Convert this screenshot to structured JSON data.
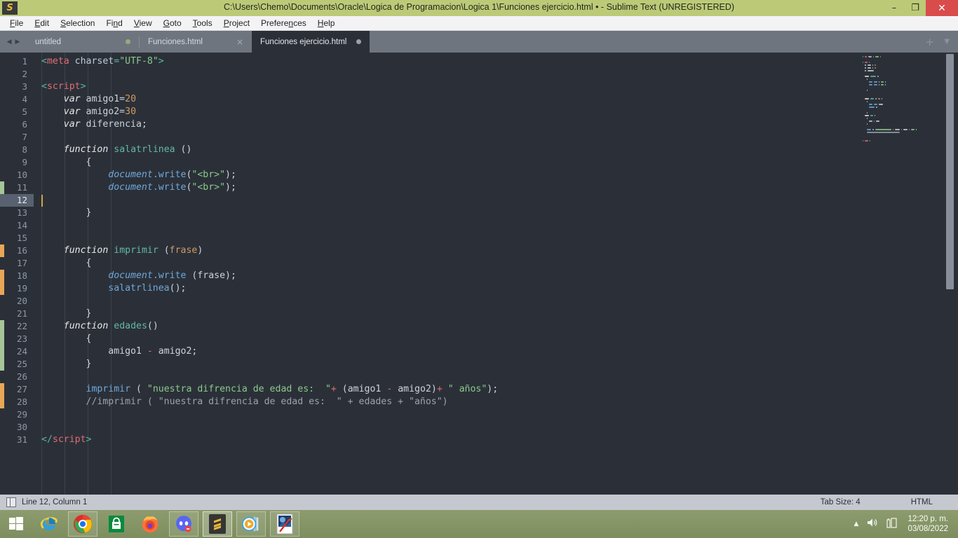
{
  "window": {
    "title": "C:\\Users\\Chemo\\Documents\\Oracle\\Logica de Programacion\\Logica 1\\Funciones ejercicio.html • - Sublime Text (UNREGISTERED)",
    "logo_glyph": "S",
    "minimize_glyph": "–",
    "maximize_glyph": "❐",
    "close_glyph": "✕"
  },
  "menubar": {
    "items": [
      {
        "pre": "",
        "accel": "F",
        "post": "ile"
      },
      {
        "pre": "",
        "accel": "E",
        "post": "dit"
      },
      {
        "pre": "",
        "accel": "S",
        "post": "election"
      },
      {
        "pre": "Fi",
        "accel": "n",
        "post": "d"
      },
      {
        "pre": "",
        "accel": "V",
        "post": "iew"
      },
      {
        "pre": "",
        "accel": "G",
        "post": "oto"
      },
      {
        "pre": "",
        "accel": "T",
        "post": "ools"
      },
      {
        "pre": "",
        "accel": "P",
        "post": "roject"
      },
      {
        "pre": "Prefere",
        "accel": "n",
        "post": "ces"
      },
      {
        "pre": "",
        "accel": "H",
        "post": "elp"
      }
    ]
  },
  "tabbar": {
    "prev_glyph": "◀",
    "next_glyph": "▶",
    "new_tab_glyph": "+",
    "menu_glyph": "▼",
    "close_glyph": "×",
    "tabs": [
      {
        "label": "untitled",
        "state": "dirty",
        "active": false
      },
      {
        "label": "Funciones.html",
        "state": "close",
        "active": false
      },
      {
        "label": "Funciones ejercicio.html",
        "state": "dirty-grey",
        "active": true
      }
    ]
  },
  "editor": {
    "cursor_line": 12,
    "first_line": 1,
    "gutter_markers": [
      {
        "line": 11,
        "type": "add"
      },
      {
        "line": 16,
        "type": "mod"
      },
      {
        "line": 18,
        "type": "mod"
      },
      {
        "line": 19,
        "type": "mod"
      },
      {
        "line": 22,
        "type": "add"
      },
      {
        "line": 23,
        "type": "add"
      },
      {
        "line": 24,
        "type": "add"
      },
      {
        "line": 25,
        "type": "add"
      },
      {
        "line": 27,
        "type": "mod"
      },
      {
        "line": 28,
        "type": "mod"
      }
    ],
    "lines": [
      {
        "n": 1,
        "tokens": [
          {
            "t": "<",
            "c": "t-punct"
          },
          {
            "t": "meta",
            "c": "t-tag"
          },
          {
            "t": " ",
            "c": "t-plain"
          },
          {
            "t": "charset",
            "c": "t-attrname"
          },
          {
            "t": "=",
            "c": "t-punct"
          },
          {
            "t": "\"UTF-8\"",
            "c": "t-str"
          },
          {
            "t": ">",
            "c": "t-punct"
          }
        ]
      },
      {
        "n": 2,
        "tokens": []
      },
      {
        "n": 3,
        "tokens": [
          {
            "t": "<",
            "c": "t-punct"
          },
          {
            "t": "script",
            "c": "t-tag"
          },
          {
            "t": ">",
            "c": "t-punct"
          }
        ]
      },
      {
        "n": 4,
        "tokens": [
          {
            "t": "    ",
            "c": "t-plain"
          },
          {
            "t": "var",
            "c": "t-kw"
          },
          {
            "t": " amigo1",
            "c": "t-plain"
          },
          {
            "t": "=",
            "c": "t-plain"
          },
          {
            "t": "20",
            "c": "t-num"
          }
        ]
      },
      {
        "n": 5,
        "tokens": [
          {
            "t": "    ",
            "c": "t-plain"
          },
          {
            "t": "var",
            "c": "t-kw"
          },
          {
            "t": " amigo2",
            "c": "t-plain"
          },
          {
            "t": "=",
            "c": "t-plain"
          },
          {
            "t": "30",
            "c": "t-num"
          }
        ]
      },
      {
        "n": 6,
        "tokens": [
          {
            "t": "    ",
            "c": "t-plain"
          },
          {
            "t": "var",
            "c": "t-kw"
          },
          {
            "t": " diferencia;",
            "c": "t-plain"
          }
        ]
      },
      {
        "n": 7,
        "tokens": []
      },
      {
        "n": 8,
        "tokens": [
          {
            "t": "    ",
            "c": "t-plain"
          },
          {
            "t": "function",
            "c": "t-kw"
          },
          {
            "t": " ",
            "c": "t-plain"
          },
          {
            "t": "salatrlinea",
            "c": "t-fn"
          },
          {
            "t": " ()",
            "c": "t-plain"
          }
        ]
      },
      {
        "n": 9,
        "tokens": [
          {
            "t": "        {",
            "c": "t-plain"
          }
        ]
      },
      {
        "n": 10,
        "tokens": [
          {
            "t": "            ",
            "c": "t-plain"
          },
          {
            "t": "document",
            "c": "t-obj"
          },
          {
            "t": ".write",
            "c": "t-meth"
          },
          {
            "t": "(",
            "c": "t-plain"
          },
          {
            "t": "\"<br>\"",
            "c": "t-str"
          },
          {
            "t": ");",
            "c": "t-plain"
          }
        ]
      },
      {
        "n": 11,
        "tokens": [
          {
            "t": "            ",
            "c": "t-plain"
          },
          {
            "t": "document",
            "c": "t-obj"
          },
          {
            "t": ".write",
            "c": "t-meth"
          },
          {
            "t": "(",
            "c": "t-plain"
          },
          {
            "t": "\"<br>\"",
            "c": "t-str"
          },
          {
            "t": ");",
            "c": "t-plain"
          }
        ]
      },
      {
        "n": 12,
        "tokens": []
      },
      {
        "n": 13,
        "tokens": [
          {
            "t": "        }",
            "c": "t-plain"
          }
        ]
      },
      {
        "n": 14,
        "tokens": []
      },
      {
        "n": 15,
        "tokens": []
      },
      {
        "n": 16,
        "tokens": [
          {
            "t": "    ",
            "c": "t-plain"
          },
          {
            "t": "function",
            "c": "t-kw"
          },
          {
            "t": " ",
            "c": "t-plain"
          },
          {
            "t": "imprimir",
            "c": "t-fn"
          },
          {
            "t": " (",
            "c": "t-plain"
          },
          {
            "t": "frase",
            "c": "t-param"
          },
          {
            "t": ")",
            "c": "t-plain"
          }
        ]
      },
      {
        "n": 17,
        "tokens": [
          {
            "t": "        {",
            "c": "t-plain"
          }
        ]
      },
      {
        "n": 18,
        "tokens": [
          {
            "t": "            ",
            "c": "t-plain"
          },
          {
            "t": "document",
            "c": "t-obj"
          },
          {
            "t": ".write",
            "c": "t-meth"
          },
          {
            "t": " (frase);",
            "c": "t-plain"
          }
        ]
      },
      {
        "n": 19,
        "tokens": [
          {
            "t": "            ",
            "c": "t-plain"
          },
          {
            "t": "salatrlinea",
            "c": "t-meth"
          },
          {
            "t": "();",
            "c": "t-plain"
          }
        ]
      },
      {
        "n": 20,
        "tokens": []
      },
      {
        "n": 21,
        "tokens": [
          {
            "t": "        }",
            "c": "t-plain"
          }
        ]
      },
      {
        "n": 22,
        "tokens": [
          {
            "t": "    ",
            "c": "t-plain"
          },
          {
            "t": "function",
            "c": "t-kw"
          },
          {
            "t": " ",
            "c": "t-plain"
          },
          {
            "t": "edades",
            "c": "t-fn"
          },
          {
            "t": "()",
            "c": "t-plain"
          }
        ]
      },
      {
        "n": 23,
        "tokens": [
          {
            "t": "        {",
            "c": "t-plain"
          }
        ]
      },
      {
        "n": 24,
        "tokens": [
          {
            "t": "            amigo1 ",
            "c": "t-plain"
          },
          {
            "t": "-",
            "c": "t-op"
          },
          {
            "t": " amigo2;",
            "c": "t-plain"
          }
        ]
      },
      {
        "n": 25,
        "tokens": [
          {
            "t": "        }",
            "c": "t-plain"
          }
        ]
      },
      {
        "n": 26,
        "tokens": []
      },
      {
        "n": 27,
        "tokens": [
          {
            "t": "        ",
            "c": "t-plain"
          },
          {
            "t": "imprimir",
            "c": "t-meth"
          },
          {
            "t": " ( ",
            "c": "t-plain"
          },
          {
            "t": "\"nuestra difrencia de edad es:  \"",
            "c": "t-str"
          },
          {
            "t": "+",
            "c": "t-op"
          },
          {
            "t": " (amigo1 ",
            "c": "t-plain"
          },
          {
            "t": "-",
            "c": "t-op"
          },
          {
            "t": " amigo2)",
            "c": "t-plain"
          },
          {
            "t": "+",
            "c": "t-op"
          },
          {
            "t": " ",
            "c": "t-plain"
          },
          {
            "t": "\" años\"",
            "c": "t-str"
          },
          {
            "t": ");",
            "c": "t-plain"
          }
        ]
      },
      {
        "n": 28,
        "tokens": [
          {
            "t": "        //imprimir ( \"nuestra difrencia de edad es:  \" + edades + \"años\")",
            "c": "t-comment"
          }
        ]
      },
      {
        "n": 29,
        "tokens": []
      },
      {
        "n": 30,
        "tokens": []
      },
      {
        "n": 31,
        "tokens": [
          {
            "t": "</",
            "c": "t-punct"
          },
          {
            "t": "script",
            "c": "t-tag"
          },
          {
            "t": ">",
            "c": "t-punct"
          }
        ]
      }
    ]
  },
  "statusbar": {
    "position": "Line 12, Column 1",
    "tab_size": "Tab Size: 4",
    "syntax": "HTML"
  },
  "taskbar": {
    "items": [
      {
        "name": "start-button",
        "glyph": "win"
      },
      {
        "name": "taskbar-item-internet-explorer",
        "glyph": "ie",
        "framed": false
      },
      {
        "name": "taskbar-item-google-chrome",
        "glyph": "chrome",
        "framed": true
      },
      {
        "name": "taskbar-item-microsoft-store",
        "glyph": "store",
        "framed": false
      },
      {
        "name": "taskbar-item-firefox",
        "glyph": "firefox",
        "framed": false
      },
      {
        "name": "taskbar-item-discord",
        "glyph": "discord",
        "framed": true
      },
      {
        "name": "taskbar-item-sublime-text",
        "glyph": "sublime",
        "framed": true,
        "active": true
      },
      {
        "name": "taskbar-item-media-player",
        "glyph": "media",
        "framed": true
      },
      {
        "name": "taskbar-item-image-editor",
        "glyph": "paint",
        "framed": true
      }
    ],
    "tray": {
      "show_hidden_glyph": "▲",
      "volume_glyph": "🔊",
      "network_glyph": "▕▏",
      "time": "12:20 p. m.",
      "date": "03/08/2022"
    }
  },
  "colors": {
    "titlebar": "#bcca78",
    "menubar": "#f3f3f6",
    "tabbar": "#6f757f",
    "editor_bg": "#2b3038",
    "statusbar": "#c6c8d0",
    "taskbar": "#869667",
    "close_button": "#d94c4c",
    "cursor": "#d4a24a",
    "gutter_add": "#a6c69a",
    "gutter_mod": "#e8a657"
  }
}
